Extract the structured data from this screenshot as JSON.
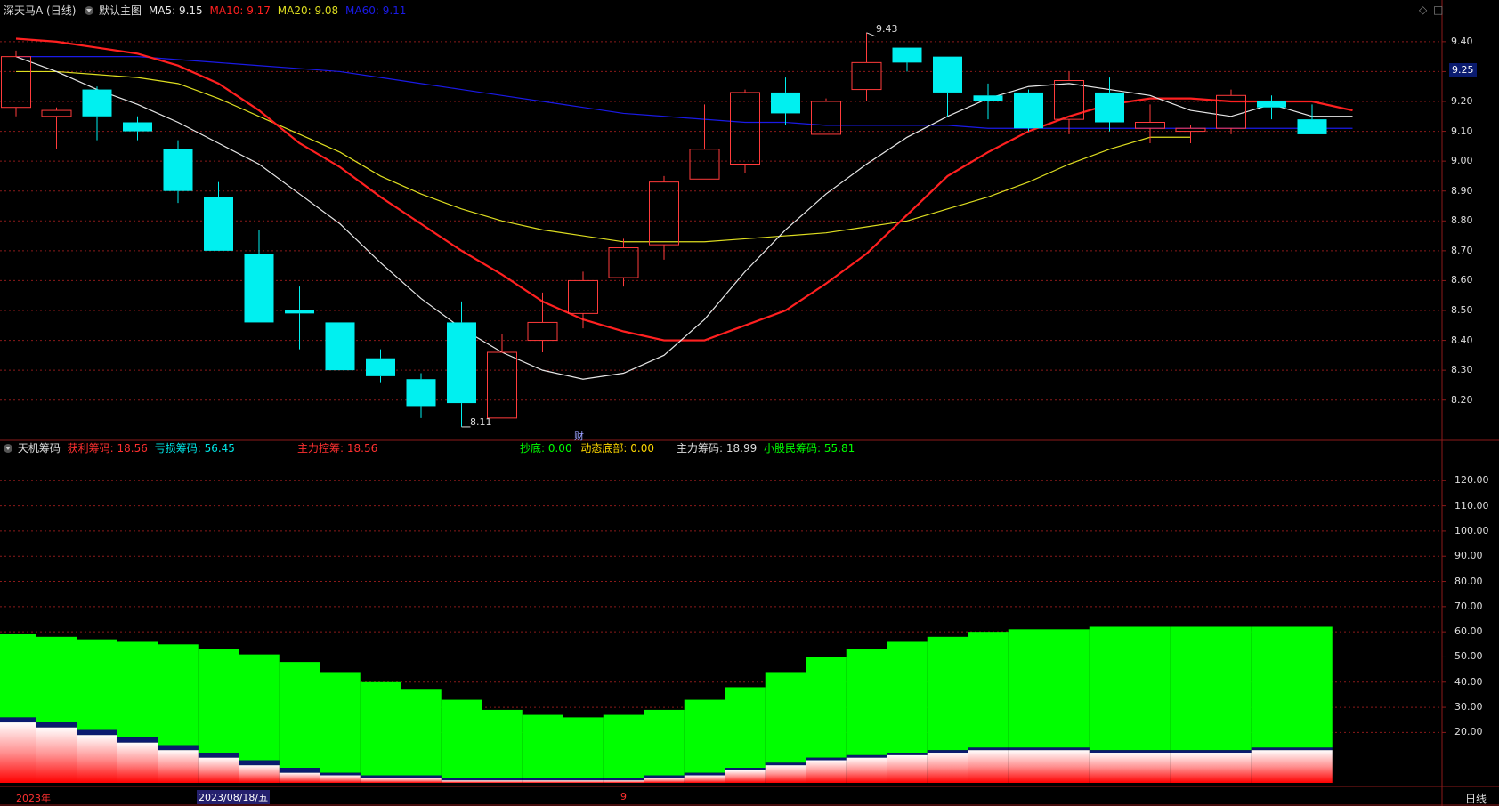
{
  "colors": {
    "up": "#ff3b3b",
    "down": "#00f0f0",
    "ma5": "#e6e6e6",
    "ma10": "#ff2020",
    "ma20": "#dddd20",
    "ma60": "#1a1ae6",
    "grid": "#8b1a1a",
    "axis_text": "#dddddd",
    "profit_green": "#00ff00",
    "loss_red": "#ff0000",
    "navy": "#0a1b6e"
  },
  "header": {
    "stock_name": "深天马A (日线)",
    "chart_type": "默认主图",
    "ma5": "MA5: 9.15",
    "ma10": "MA10: 9.17",
    "ma20": "MA20: 9.08",
    "ma60": "MA60: 9.11"
  },
  "indicator_header": {
    "name": "天机筹码",
    "profit": "获利筹码: 18.56",
    "loss": "亏损筹码: 56.45",
    "main_control": "主力控筹: 18.56",
    "bottom": "抄底: 0.00",
    "dynamic_bottom": "动态底部: 0.00",
    "main_chips": "主力筹码: 18.99",
    "retail_chips": "小股民筹码: 55.81"
  },
  "price_axis": {
    "ticks": [
      "9.40",
      "9.30",
      "9.20",
      "9.10",
      "9.00",
      "8.90",
      "8.80",
      "8.70",
      "8.60",
      "8.50",
      "8.40",
      "8.30",
      "8.20"
    ],
    "min": 8.08,
    "max": 9.48,
    "current": "9.25"
  },
  "annotations": {
    "high": "9.43",
    "low": "8.11",
    "marker": "财"
  },
  "indicator_axis": {
    "ticks": [
      "120.00",
      "110.00",
      "100.00",
      "90.00",
      "80.00",
      "70.00",
      "60.00",
      "50.00",
      "40.00",
      "30.00",
      "20.00"
    ]
  },
  "dates": {
    "left": "2023年",
    "selected": "2023/08/18/五",
    "month": "9"
  },
  "period": "日线",
  "chart_data": [
    {
      "type": "candlestick",
      "candles": [
        {
          "o": 9.18,
          "h": 9.37,
          "l": 9.15,
          "c": 9.35
        },
        {
          "o": 9.15,
          "h": 9.18,
          "l": 9.04,
          "c": 9.17
        },
        {
          "o": 9.24,
          "h": 9.25,
          "l": 9.07,
          "c": 9.15
        },
        {
          "o": 9.13,
          "h": 9.15,
          "l": 9.07,
          "c": 9.1
        },
        {
          "o": 9.04,
          "h": 9.07,
          "l": 8.86,
          "c": 8.9
        },
        {
          "o": 8.88,
          "h": 8.93,
          "l": 8.7,
          "c": 8.7
        },
        {
          "o": 8.69,
          "h": 8.77,
          "l": 8.46,
          "c": 8.46
        },
        {
          "o": 8.5,
          "h": 8.58,
          "l": 8.37,
          "c": 8.49
        },
        {
          "o": 8.46,
          "h": 8.46,
          "l": 8.3,
          "c": 8.3
        },
        {
          "o": 8.34,
          "h": 8.37,
          "l": 8.26,
          "c": 8.28
        },
        {
          "o": 8.27,
          "h": 8.29,
          "l": 8.14,
          "c": 8.18
        },
        {
          "o": 8.46,
          "h": 8.53,
          "l": 8.11,
          "c": 8.19
        },
        {
          "o": 8.14,
          "h": 8.42,
          "l": 8.14,
          "c": 8.36
        },
        {
          "o": 8.4,
          "h": 8.56,
          "l": 8.36,
          "c": 8.46
        },
        {
          "o": 8.49,
          "h": 8.63,
          "l": 8.44,
          "c": 8.6
        },
        {
          "o": 8.61,
          "h": 8.74,
          "l": 8.58,
          "c": 8.71
        },
        {
          "o": 8.72,
          "h": 8.95,
          "l": 8.67,
          "c": 8.93
        },
        {
          "o": 8.94,
          "h": 9.19,
          "l": 8.94,
          "c": 9.04
        },
        {
          "o": 8.99,
          "h": 9.24,
          "l": 8.96,
          "c": 9.23
        },
        {
          "o": 9.23,
          "h": 9.28,
          "l": 9.12,
          "c": 9.16
        },
        {
          "o": 9.09,
          "h": 9.21,
          "l": 9.09,
          "c": 9.2
        },
        {
          "o": 9.24,
          "h": 9.43,
          "l": 9.2,
          "c": 9.33
        },
        {
          "o": 9.38,
          "h": 9.38,
          "l": 9.3,
          "c": 9.33
        },
        {
          "o": 9.35,
          "h": 9.35,
          "l": 9.15,
          "c": 9.23
        },
        {
          "o": 9.22,
          "h": 9.26,
          "l": 9.14,
          "c": 9.2
        },
        {
          "o": 9.23,
          "h": 9.24,
          "l": 9.1,
          "c": 9.11
        },
        {
          "o": 9.14,
          "h": 9.3,
          "l": 9.09,
          "c": 9.27
        },
        {
          "o": 9.23,
          "h": 9.28,
          "l": 9.1,
          "c": 9.13
        },
        {
          "o": 9.11,
          "h": 9.19,
          "l": 9.06,
          "c": 9.13
        },
        {
          "o": 9.1,
          "h": 9.12,
          "l": 9.06,
          "c": 9.11
        },
        {
          "o": 9.11,
          "h": 9.24,
          "l": 9.09,
          "c": 9.22
        },
        {
          "o": 9.2,
          "h": 9.22,
          "l": 9.14,
          "c": 9.18
        },
        {
          "o": 9.14,
          "h": 9.19,
          "l": 9.09,
          "c": 9.09
        }
      ],
      "ma5": [
        9.35,
        9.3,
        9.24,
        9.19,
        9.13,
        9.06,
        8.99,
        8.89,
        8.79,
        8.66,
        8.54,
        8.44,
        8.36,
        8.3,
        8.27,
        8.29,
        8.35,
        8.47,
        8.63,
        8.77,
        8.89,
        8.99,
        9.08,
        9.15,
        9.21,
        9.25,
        9.26,
        9.24,
        9.22,
        9.17,
        9.15,
        9.19,
        9.15,
        9.15
      ],
      "ma10": [
        9.41,
        9.4,
        9.38,
        9.36,
        9.32,
        9.26,
        9.17,
        9.06,
        8.98,
        8.88,
        8.79,
        8.7,
        8.62,
        8.53,
        8.47,
        8.43,
        8.4,
        8.4,
        8.45,
        8.5,
        8.59,
        8.69,
        8.82,
        8.95,
        9.03,
        9.1,
        9.15,
        9.19,
        9.21,
        9.21,
        9.2,
        9.2,
        9.2,
        9.17
      ],
      "ma20": [
        9.3,
        9.3,
        9.29,
        9.28,
        9.26,
        9.21,
        9.15,
        9.09,
        9.03,
        8.95,
        8.89,
        8.84,
        8.8,
        8.77,
        8.75,
        8.73,
        8.73,
        8.73,
        8.74,
        8.75,
        8.76,
        8.78,
        8.8,
        8.84,
        8.88,
        8.93,
        8.99,
        9.04,
        9.08,
        9.08
      ],
      "ma60": [
        9.35,
        9.35,
        9.35,
        9.35,
        9.34,
        9.33,
        9.32,
        9.31,
        9.3,
        9.28,
        9.26,
        9.24,
        9.22,
        9.2,
        9.18,
        9.16,
        9.15,
        9.14,
        9.13,
        9.13,
        9.12,
        9.12,
        9.12,
        9.12,
        9.11,
        9.11,
        9.11,
        9.11,
        9.11,
        9.11,
        9.11,
        9.11,
        9.11,
        9.11
      ]
    },
    {
      "type": "area",
      "ylim": [
        0,
        130
      ],
      "green_top": [
        59,
        58,
        57,
        56,
        55,
        53,
        51,
        48,
        44,
        40,
        37,
        33,
        29,
        27,
        26,
        27,
        29,
        33,
        38,
        44,
        50,
        53,
        56,
        58,
        60,
        61,
        61,
        62,
        62,
        62,
        62,
        62,
        62,
        62
      ],
      "white_top": [
        24,
        22,
        19,
        16,
        13,
        10,
        7,
        4,
        3,
        2,
        2,
        1,
        1,
        1,
        1,
        1,
        2,
        3,
        5,
        7,
        9,
        10,
        11,
        12,
        13,
        13,
        13,
        12,
        12,
        12,
        12,
        13,
        13,
        12
      ],
      "red_top": [
        24,
        22,
        19,
        16,
        13,
        10,
        7,
        4,
        3,
        2,
        2,
        1,
        1,
        1,
        1,
        1,
        2,
        3,
        5,
        7,
        9,
        10,
        11,
        12,
        13,
        13,
        13,
        12,
        12,
        12,
        12,
        13,
        13,
        12
      ],
      "navy_top": [
        26,
        24,
        21,
        18,
        15,
        12,
        9,
        6,
        4,
        3,
        3,
        2,
        2,
        2,
        2,
        2,
        3,
        4,
        6,
        8,
        10,
        11,
        12,
        13,
        14,
        14,
        14,
        13,
        13,
        13,
        13,
        14,
        14,
        13
      ]
    }
  ]
}
